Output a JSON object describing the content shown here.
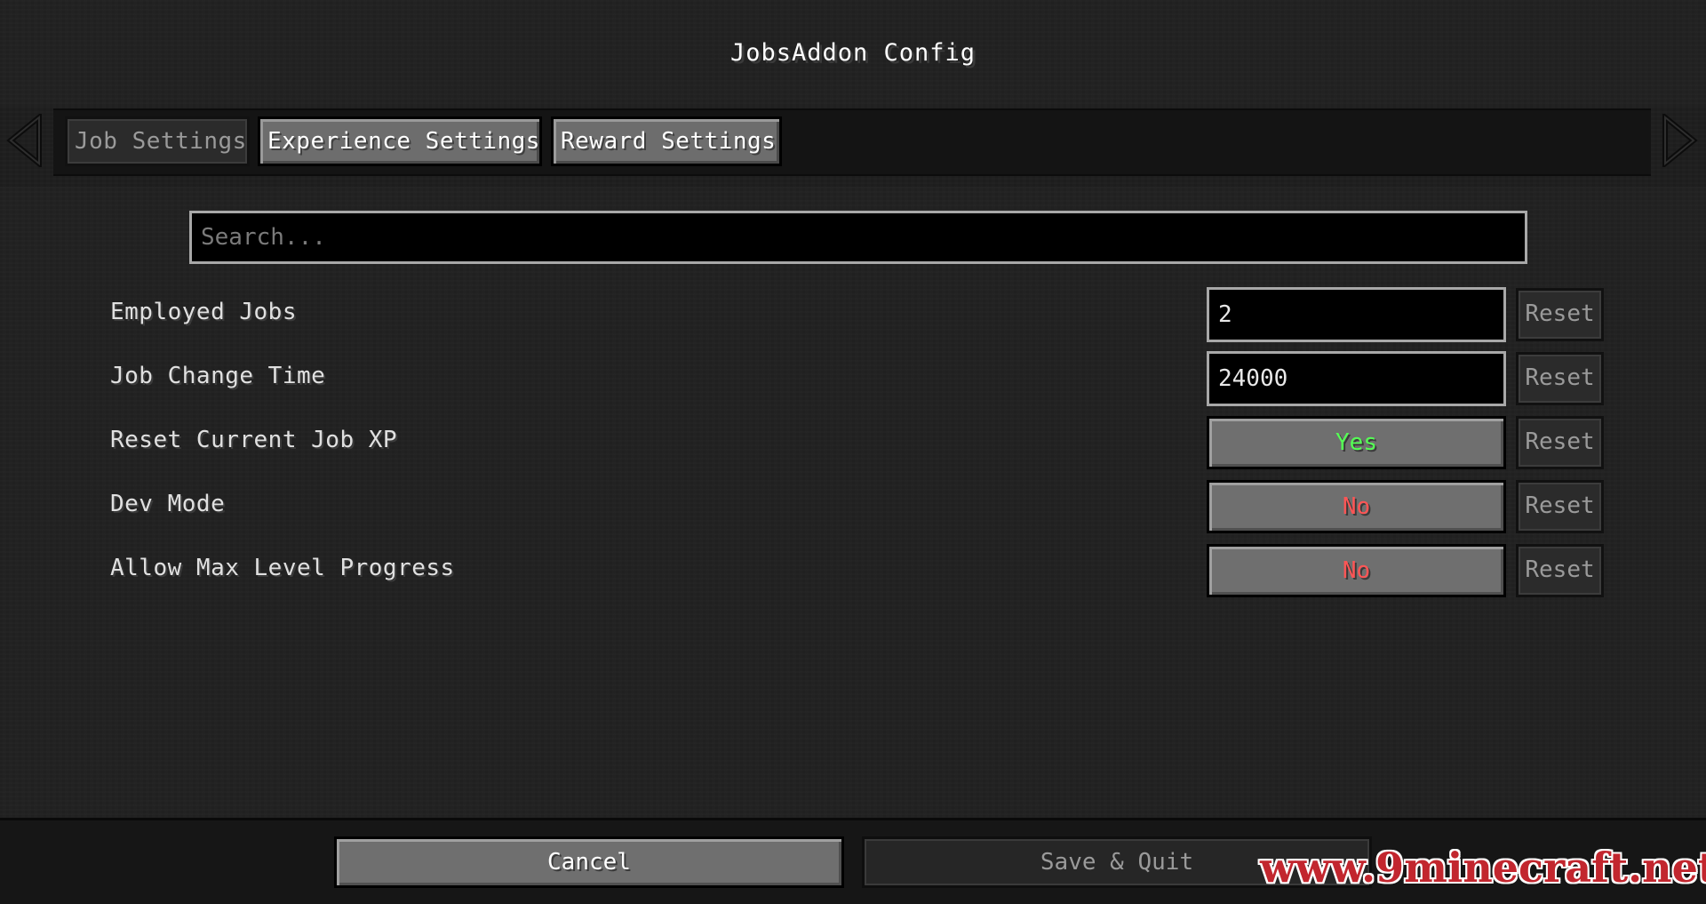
{
  "title": "JobsAddon Config",
  "tabs": [
    {
      "label": "Job Settings",
      "active": true
    },
    {
      "label": "Experience Settings",
      "active": false
    },
    {
      "label": "Reward Settings",
      "active": false
    }
  ],
  "search": {
    "placeholder": "Search...",
    "value": ""
  },
  "settings": [
    {
      "label": "Employed Jobs",
      "type": "text",
      "value": "2",
      "reset_label": "Reset"
    },
    {
      "label": "Job Change Time",
      "type": "text",
      "value": "24000",
      "reset_label": "Reset"
    },
    {
      "label": "Reset Current Job XP",
      "type": "toggle",
      "value": "Yes",
      "color": "#55ff55",
      "reset_label": "Reset"
    },
    {
      "label": "Dev Mode",
      "type": "toggle",
      "value": "No",
      "color": "#ff5555",
      "reset_label": "Reset"
    },
    {
      "label": "Allow Max Level Progress",
      "type": "toggle",
      "value": "No",
      "color": "#ff5555",
      "reset_label": "Reset"
    }
  ],
  "footer": {
    "cancel_label": "Cancel",
    "save_label": "Save & Quit"
  },
  "watermark": "www.9minecraft.net",
  "icons": {
    "prev": "arrow-left-icon",
    "next": "arrow-right-icon"
  }
}
